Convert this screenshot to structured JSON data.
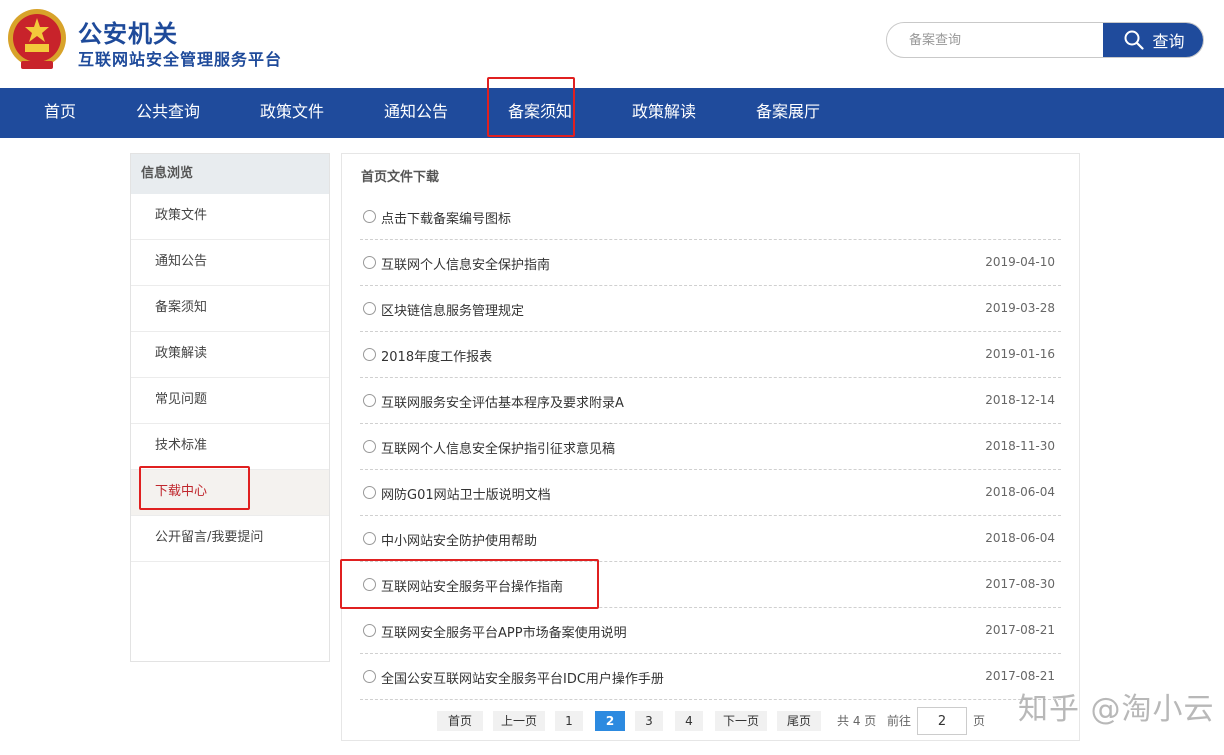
{
  "header": {
    "title": "公安机关",
    "subtitle": "互联网站安全管理服务平台",
    "search_placeholder": "备案查询",
    "search_button": "查询"
  },
  "nav": {
    "items": [
      "首页",
      "公共查询",
      "政策文件",
      "通知公告",
      "备案须知",
      "政策解读",
      "备案展厅"
    ]
  },
  "sidebar": {
    "heading": "信息浏览",
    "items": [
      "政策文件",
      "通知公告",
      "备案须知",
      "政策解读",
      "常见问题",
      "技术标准",
      "下载中心",
      "公开留言/我要提问"
    ],
    "active": "下载中心"
  },
  "main": {
    "title": "首页文件下载",
    "rows": [
      {
        "title": "点击下载备案编号图标",
        "date": ""
      },
      {
        "title": "互联网个人信息安全保护指南",
        "date": "2019-04-10"
      },
      {
        "title": "区块链信息服务管理规定",
        "date": "2019-03-28"
      },
      {
        "title": "2018年度工作报表",
        "date": "2019-01-16"
      },
      {
        "title": "互联网服务安全评估基本程序及要求附录A",
        "date": "2018-12-14"
      },
      {
        "title": "互联网个人信息安全保护指引征求意见稿",
        "date": "2018-11-30"
      },
      {
        "title": "网防G01网站卫士版说明文档",
        "date": "2018-06-04"
      },
      {
        "title": "中小网站安全防护使用帮助",
        "date": "2018-06-04"
      },
      {
        "title": "互联网站安全服务平台操作指南",
        "date": "2017-08-30"
      },
      {
        "title": "互联网安全服务平台APP市场备案使用说明",
        "date": "2017-08-21"
      },
      {
        "title": "全国公安互联网站安全服务平台IDC用户操作手册",
        "date": "2017-08-21"
      }
    ]
  },
  "pagination": {
    "first": "首页",
    "prev": "上一页",
    "pages": [
      "1",
      "2",
      "3",
      "4"
    ],
    "current": "2",
    "next": "下一页",
    "last": "尾页",
    "total": "共 4 页",
    "goto": "前往",
    "goto_value": "2",
    "goto_suffix": "页"
  },
  "watermark": "知乎 @淘小云",
  "colors": {
    "brand_blue": "#1f4b9c",
    "active_red": "#c0272d",
    "highlight_box": "#e02020",
    "current_page": "#2c8ae0"
  }
}
